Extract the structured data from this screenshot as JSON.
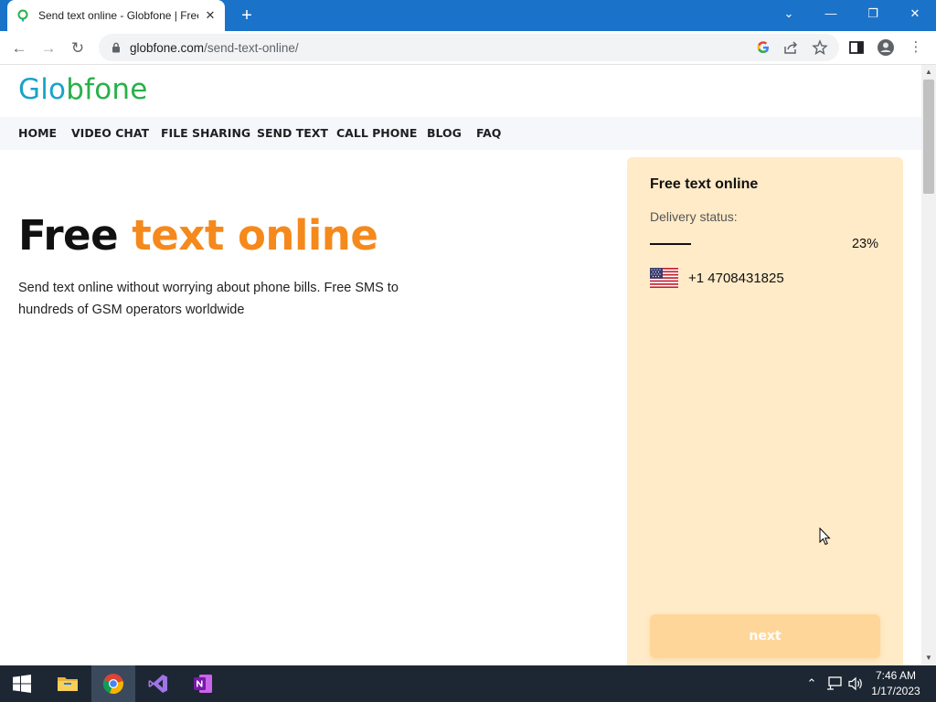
{
  "browser": {
    "tab_title": "Send text online - Globfone | Free",
    "tab_close": "✕",
    "new_tab": "+",
    "url_host": "globfone.com",
    "url_path": "/send-text-online/",
    "window_controls": {
      "dropdown": "⌄",
      "minimize": "—",
      "restore": "❐",
      "close": "✕"
    },
    "nav": {
      "back": "←",
      "forward": "→",
      "reload": "↻"
    },
    "menu": "⋮"
  },
  "site": {
    "logo_part1": "Glo",
    "logo_part2": "bfone",
    "nav": [
      "HOME",
      "VIDEO CHAT",
      "FILE SHARING",
      "SEND TEXT",
      "CALL PHONE",
      "BLOG",
      "FAQ"
    ],
    "hero_title_plain": "Free",
    "hero_title_accent": "text online",
    "hero_subtitle": "Send text online without worrying about phone bills. Free SMS to hundreds of GSM operators worldwide"
  },
  "panel": {
    "title": "Free text online",
    "delivery_label": "Delivery status:",
    "progress_percent": 23,
    "progress_text": "23%",
    "phone_number": "+1 4708431825",
    "next_label": "next"
  },
  "taskbar": {
    "time": "7:46 AM",
    "date": "1/17/2023"
  },
  "colors": {
    "chrome_blue": "#1a73c9",
    "accent_orange": "#f5891c",
    "panel_bg": "#ffebc8",
    "next_btn": "#ffd69a",
    "logo_blue": "#1aa3c9",
    "logo_green": "#29b04a"
  }
}
